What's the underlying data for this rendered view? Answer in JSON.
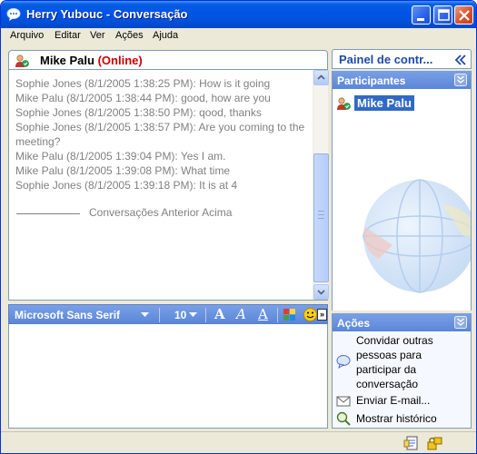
{
  "window": {
    "title": "Herry Yubouc - Conversação",
    "controls": [
      "minimize-icon",
      "maximize-icon",
      "close-icon"
    ]
  },
  "menu": [
    "Arquivo",
    "Editar",
    "Ver",
    "Ações",
    "Ajuda"
  ],
  "conversation": {
    "contact_name": "Mike Palu",
    "contact_status": "(Online)",
    "status_color": "#cc0000",
    "history": [
      "Sophie Jones  (8/1/2005 1:38:25 PM): How is it going",
      "Mike Palu  (8/1/2005 1:38:44 PM): good, how are you",
      "Sophie Jones  (8/1/2005 1:38:50 PM): qood, thanks",
      "Sophie Jones  (8/1/2005 1:38:57 PM): Are you coming to the meeting?",
      "Mike Palu  (8/1/2005 1:39:04 PM): Yes I am.",
      "Mike Palu  (8/1/2005 1:39:08 PM): What time",
      "Sophie Jones  (8/1/2005 1:39:18 PM): It is at 4"
    ],
    "separator_text": "Conversações Anterior Acima"
  },
  "format_toolbar": {
    "font": "Microsoft Sans Serif",
    "size": "10",
    "bold_label": "A",
    "italic_label": "A",
    "underline_label": "A",
    "more_label": "»"
  },
  "panel": {
    "title": "Painel de contr...",
    "participants": {
      "title": "Participantes",
      "items": [
        {
          "name": "Mike Palu"
        }
      ]
    },
    "actions": {
      "title": "Ações",
      "items": [
        {
          "label": "Convidar outras pessoas para participar da conversação",
          "icon": "invite-icon"
        },
        {
          "label": "Enviar E-mail...",
          "icon": "email-icon"
        },
        {
          "label": "Mostrar histórico",
          "icon": "history-icon"
        }
      ]
    }
  },
  "colors": {
    "titlebar": "#0055e5",
    "accent": "#5b86d8",
    "selection": "#316ac5"
  }
}
